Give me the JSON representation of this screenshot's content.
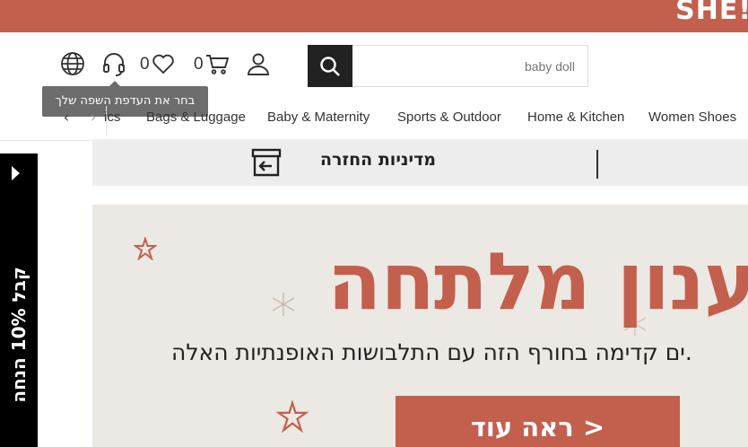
{
  "promo": {
    "text": "SHE!"
  },
  "header": {
    "search": {
      "placeholder": "baby doll",
      "button_icon": "search-icon"
    },
    "wishlist_count": "0",
    "cart_count": "0",
    "language_tooltip": "בחר את העדפת השפה שלך",
    "icons": [
      "globe-icon",
      "headset-icon",
      "heart-icon",
      "cart-icon",
      "user-icon"
    ]
  },
  "nav": {
    "items": [
      {
        "label": "ics"
      },
      {
        "label": "Bags & Luggage"
      },
      {
        "label": "Baby & Maternity"
      },
      {
        "label": "Sports & Outdoor"
      },
      {
        "label": "Home & Kitchen"
      },
      {
        "label": "Women Shoes"
      }
    ],
    "prev_arrow": "‹",
    "next_arrow": "›"
  },
  "info_strip": {
    "return_policy": "מדיניות החזרה"
  },
  "side_tab": {
    "text": "קבל 10% הנחה"
  },
  "banner": {
    "headline": "רענון מלתחה",
    "subtext": "ים קדימה בחורף הזה עם התלבושות האופנתיות האלה.",
    "button": "ראה עוד >"
  },
  "colors": {
    "accent": "#c35f4d",
    "dark": "#222222",
    "banner_bg": "#ece8e3",
    "strip_bg": "#ededed"
  }
}
